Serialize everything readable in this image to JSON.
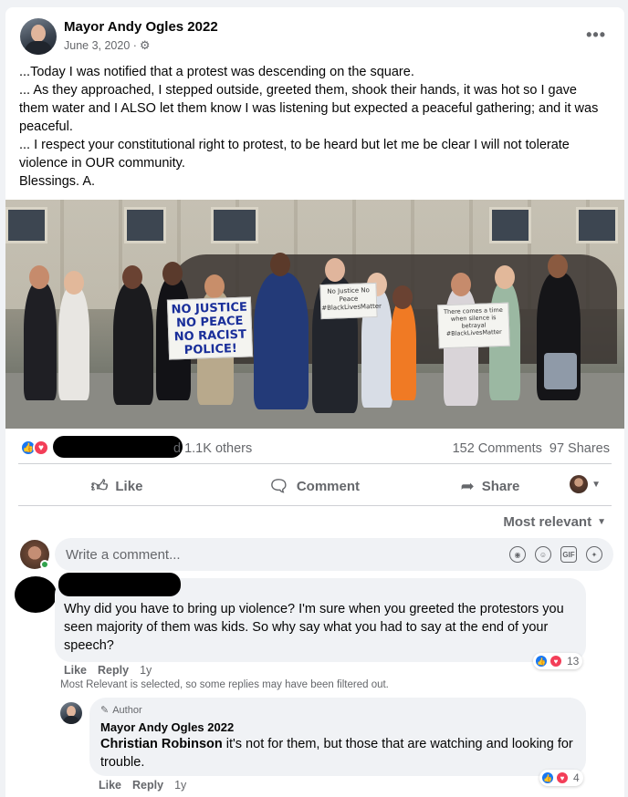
{
  "post": {
    "author": "Mayor Andy Ogles 2022",
    "date": "June 3, 2020 ·",
    "privacy_icon": "gear-icon",
    "more_icon": "•••",
    "text": "...Today I was notified that a protest was descending on the square.\n... As they approached, I stepped outside,  greeted them, shook their hands, it was hot so I gave them water and I ALSO let them know I was listening but expected a peaceful gathering; and it was peaceful.\n... I respect your constitutional right to protest, to be heard but let me be clear I will not tolerate violence in OUR community.\nBlessings. A."
  },
  "photo": {
    "signs": [
      "NO JUSTICE NO PEACE NO RACIST POLICE!",
      "No Justice No Peace #BlackLivesMatter",
      "There comes a time when silence is betrayal #BlackLivesMatter"
    ]
  },
  "stats": {
    "reactions_text": "d 1.1K others",
    "comments": "152 Comments",
    "shares": "97 Shares"
  },
  "actions": {
    "like": "Like",
    "comment": "Comment",
    "share": "Share"
  },
  "sort": {
    "label": "Most relevant"
  },
  "composer": {
    "placeholder": "Write a comment..."
  },
  "comment1": {
    "text": "Why did you have to bring up violence? I'm sure when you greeted the protestors you seen majority of them was kids. So why say what you had to say at the end of your speech?",
    "like": "Like",
    "reply": "Reply",
    "time": "1y",
    "reaction_count": "13",
    "filter_note": "Most Relevant is selected, so some replies may have been filtered out."
  },
  "reply1": {
    "badge": "Author",
    "author": "Mayor Andy Ogles 2022",
    "tag": "Christian Robinson",
    "text": " it's not for them, but those that are watching and looking for trouble.",
    "like": "Like",
    "reply": "Reply",
    "time": "1y",
    "reaction_count": "4"
  },
  "colors": {
    "accent": "#1877f2",
    "love": "#f33e58",
    "secondary_text": "#65676b",
    "bubble": "#f0f2f5"
  }
}
